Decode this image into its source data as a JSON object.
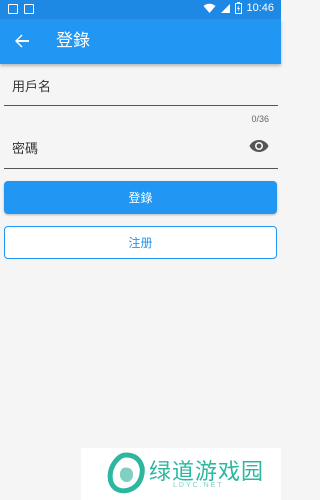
{
  "status_bar": {
    "time": "10:46"
  },
  "app_bar": {
    "title": "登錄"
  },
  "form": {
    "username_label": "用戶名",
    "password_label": "密碼",
    "password_counter": "0/36"
  },
  "buttons": {
    "login": "登錄",
    "register": "注册"
  },
  "watermark": {
    "title": "绿道游戏园",
    "subtitle": "LDYC.NET"
  },
  "colors": {
    "primary": "#2196f3",
    "status_bar": "#1e88e5",
    "watermark": "#2cb7a0"
  }
}
